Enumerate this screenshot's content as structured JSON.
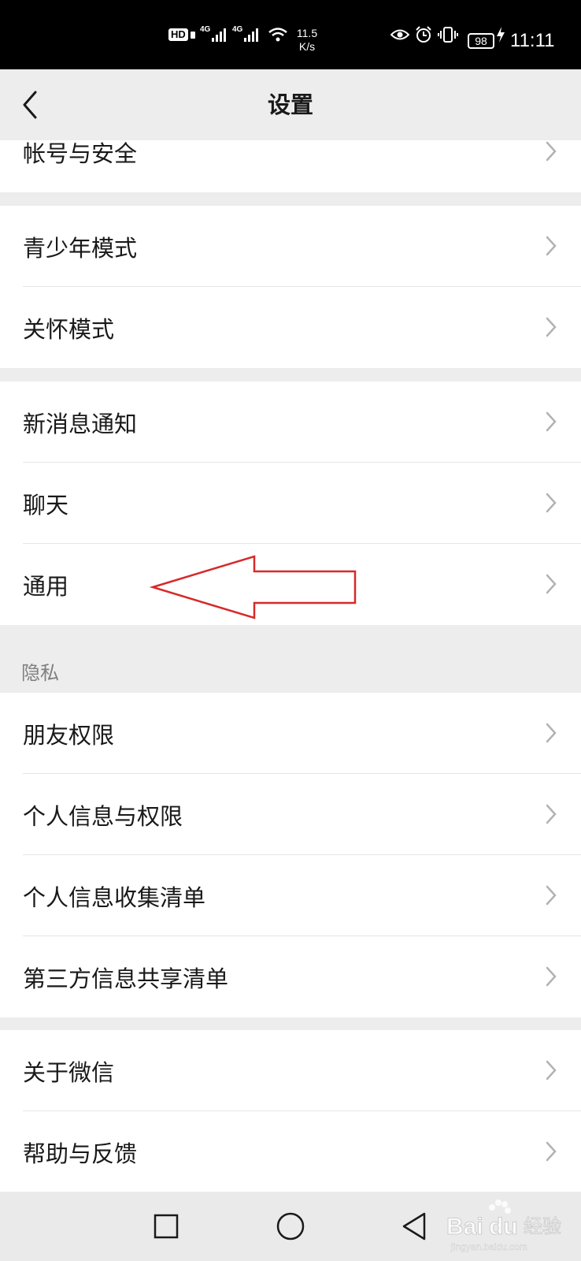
{
  "status_bar": {
    "hd_label": "HD",
    "net1": "4G",
    "net2": "4G",
    "speed_value": "11.5",
    "speed_unit": "K/s",
    "battery": "98",
    "time": "11:11"
  },
  "header": {
    "title": "设置"
  },
  "groups": [
    {
      "items": [
        {
          "label": "帐号与安全"
        }
      ]
    },
    {
      "items": [
        {
          "label": "青少年模式"
        },
        {
          "label": "关怀模式"
        }
      ]
    },
    {
      "items": [
        {
          "label": "新消息通知"
        },
        {
          "label": "聊天"
        },
        {
          "label": "通用"
        }
      ]
    },
    {
      "section": "隐私",
      "items": [
        {
          "label": "朋友权限"
        },
        {
          "label": "个人信息与权限"
        },
        {
          "label": "个人信息收集清单"
        },
        {
          "label": "第三方信息共享清单"
        }
      ]
    },
    {
      "items": [
        {
          "label": "关于微信"
        },
        {
          "label": "帮助与反馈"
        }
      ]
    }
  ],
  "watermark": {
    "brand": "Baidu",
    "label": "经验",
    "url": "jingyan.baidu.com"
  },
  "colors": {
    "annotation_arrow": "#d62a2a",
    "chevron": "#b2b2b2",
    "background": "#ededed"
  },
  "icons": [
    "back-icon",
    "chevron-right-icon",
    "square-icon",
    "circle-icon",
    "triangle-back-icon",
    "eye-icon",
    "alarm-icon",
    "vibrate-icon",
    "wifi-icon",
    "signal-icon"
  ]
}
